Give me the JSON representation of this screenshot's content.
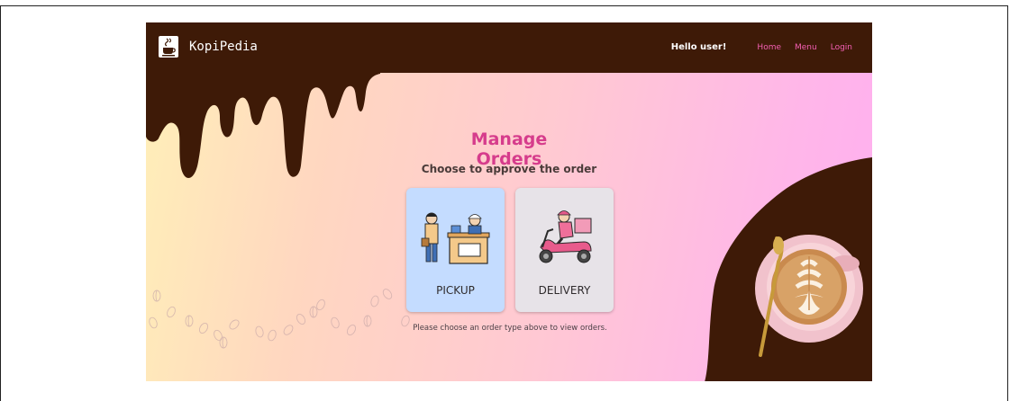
{
  "navbar": {
    "brand": "KopiPedia",
    "greeting": "Hello user!",
    "links": [
      "Home",
      "Menu",
      "Login"
    ]
  },
  "main": {
    "title": "Manage Orders",
    "subtitle": "Choose to approve the order",
    "options": [
      {
        "label": "PICKUP",
        "icon": "pickup-counter-icon"
      },
      {
        "label": "DELIVERY",
        "icon": "scooter-courier-icon"
      }
    ],
    "hint": "Please choose an order type above to view orders."
  },
  "colors": {
    "navbar": "#3e1a07",
    "accent_pink": "#d63c8c",
    "link_pink": "#f45fb3",
    "pickup_card": "#c4dcff",
    "delivery_card": "#e7e3e8"
  }
}
